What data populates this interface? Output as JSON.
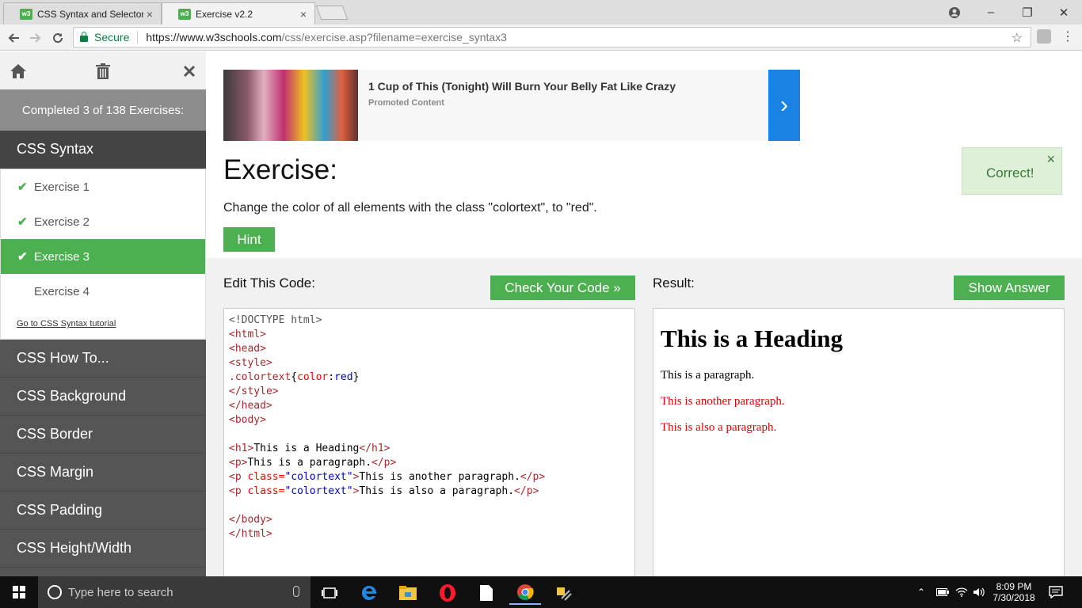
{
  "browser": {
    "tabs": [
      {
        "favicon": "w3",
        "title": "CSS Syntax and Selectors",
        "close": "×"
      },
      {
        "favicon": "w3",
        "title": "Exercise v2.2",
        "close": "×"
      }
    ],
    "secure_label": "Secure",
    "url_host": "https://www.w3schools.com",
    "url_path": "/css/exercise.asp?filename=exercise_syntax3",
    "window_controls": {
      "minimize": "–",
      "maximize": "❐",
      "close": "✕"
    }
  },
  "sidebar": {
    "progress": "Completed 3 of 138 Exercises:",
    "open_chapter": "CSS Syntax",
    "exercises": [
      {
        "label": "Exercise 1",
        "done": true
      },
      {
        "label": "Exercise 2",
        "done": true
      },
      {
        "label": "Exercise 3",
        "done": true,
        "active": true
      },
      {
        "label": "Exercise 4",
        "done": false
      }
    ],
    "tutorial_link": "Go to CSS Syntax tutorial",
    "chapters": [
      "CSS How To...",
      "CSS Background",
      "CSS Border",
      "CSS Margin",
      "CSS Padding",
      "CSS Height/Width"
    ]
  },
  "ad": {
    "title": "1 Cup of This (Tonight) Will Burn Your Belly Fat Like Crazy",
    "sub": "Promoted Content",
    "arrow": "›"
  },
  "exercise": {
    "title": "Exercise:",
    "description": "Change the color of all elements with the class \"colortext\", to \"red\".",
    "hint": "Hint",
    "correct": "Correct!",
    "correct_close": "×",
    "edit_label": "Edit This Code:",
    "check_button": "Check Your Code »",
    "result_label": "Result:",
    "show_answer": "Show Answer"
  },
  "code": {
    "doctype": "<!DOCTYPE html>",
    "html_open": "<html>",
    "head_open": "<head>",
    "style_open": "<style>",
    "rule_selector": ".colortext",
    "rule_brace_open": "{",
    "rule_property": "color",
    "rule_colon": ":",
    "rule_value": "red",
    "rule_brace_close": "}",
    "style_close": "</style>",
    "head_close": "</head>",
    "body_open": "<body>",
    "h1_open": "<h1>",
    "h1_text": "This is a Heading",
    "h1_close": "</h1>",
    "p_open": "<p>",
    "p1_text": "This is a paragraph.",
    "p_close": "</p>",
    "p_class_open": "<p",
    "p_class_attr": " class=",
    "p_class_value": "\"colortext\"",
    "p_class_gt": ">",
    "p2_text": "This is another paragraph.",
    "p3_text": "This is also a paragraph.",
    "body_close": "</body>",
    "html_close": "</html>"
  },
  "result": {
    "heading": "This is a Heading",
    "p1": "This is a paragraph.",
    "p2": "This is another paragraph.",
    "p3": "This is also a paragraph."
  },
  "taskbar": {
    "search_placeholder": "Type here to search",
    "time": "8:09 PM",
    "date": "7/30/2018"
  }
}
